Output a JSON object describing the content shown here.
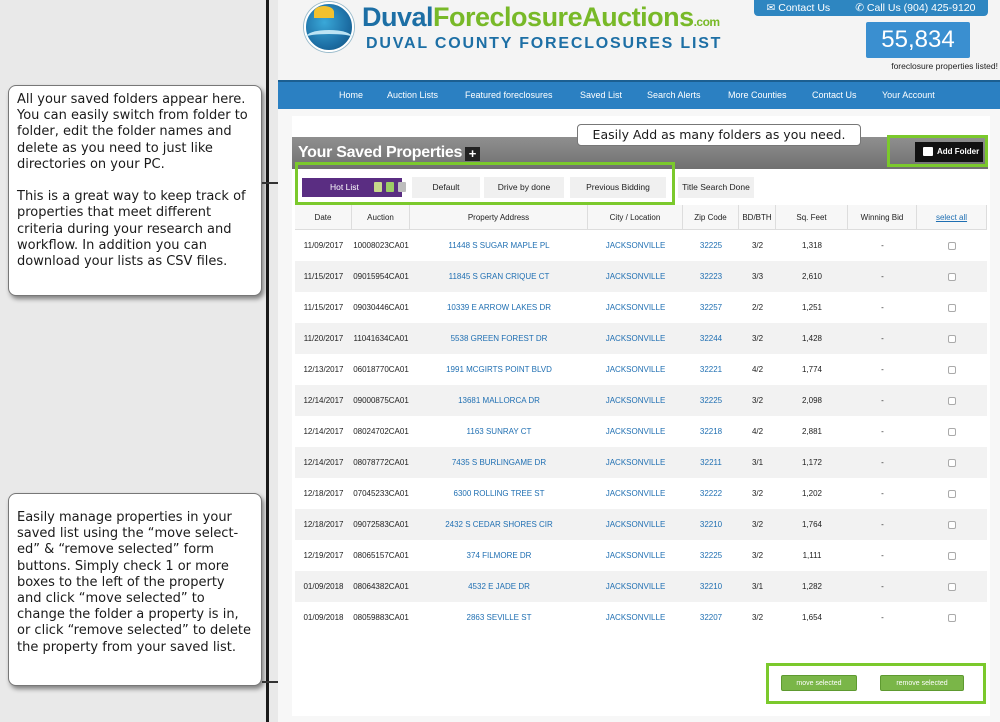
{
  "annotations": {
    "folders_note": "All your saved folders appear here. You can easily switch from folder to folder, edit the folder names and delete as you need to just like directories on your PC.\n\n This is a great way to keep track of properties that meet different criteria during your research and workflow.  In addition you can download your lists as CSV files.",
    "manage_note": "Easily manage properties in your saved list using the “move select- ed” & “remove selected” form buttons.  Simply check 1 or more boxes to the left of the property and click “move selected” to change the folder a property is in, or click “remove selected” to delete the property from your saved list.",
    "add_folder_tip": "Easily Add as many folders as you need."
  },
  "header": {
    "brand_duval": "Duval",
    "brand_fca": "ForeclosureAuctions",
    "brand_com": ".com",
    "subtitle": "DUVAL COUNTY FORECLOSURES LIST",
    "contact_us": "Contact Us",
    "call_us": "Call Us (904) 425-9120",
    "count": "55,834",
    "count_caption": "foreclosure properties listed!"
  },
  "nav": [
    "Home",
    "Auction Lists",
    "Featured foreclosures",
    "Saved List",
    "Search Alerts",
    "More Counties",
    "Contact Us",
    "Your Account"
  ],
  "saved": {
    "title": "Your Saved Properties",
    "plus": "+",
    "add_folder": "Add Folder",
    "tabs": {
      "hot": "Hot List",
      "default": "Default",
      "drive": "Drive by done",
      "previous": "Previous Bidding",
      "title_search": "Title Search Done"
    }
  },
  "table": {
    "headers": {
      "date": "Date",
      "auction": "Auction",
      "address": "Property Address",
      "city": "City / Location",
      "zip": "Zip Code",
      "bd": "BD/BTH",
      "sqft": "Sq. Feet",
      "winning": "Winning Bid",
      "select_all": "select all"
    },
    "rows": [
      {
        "date": "11/09/2017",
        "auction": "10008023CA01",
        "address": "11448 S SUGAR MAPLE PL",
        "city": "JACKSONVILLE",
        "zip": "32225",
        "bd": "3/2",
        "sqft": "1,318",
        "win": "-"
      },
      {
        "date": "11/15/2017",
        "auction": "09015954CA01",
        "address": "11845 S GRAN CRIQUE CT",
        "city": "JACKSONVILLE",
        "zip": "32223",
        "bd": "3/3",
        "sqft": "2,610",
        "win": "-"
      },
      {
        "date": "11/15/2017",
        "auction": "09030446CA01",
        "address": "10339 E ARROW LAKES DR",
        "city": "JACKSONVILLE",
        "zip": "32257",
        "bd": "2/2",
        "sqft": "1,251",
        "win": "-"
      },
      {
        "date": "11/20/2017",
        "auction": "11041634CA01",
        "address": "5538 GREEN FOREST DR",
        "city": "JACKSONVILLE",
        "zip": "32244",
        "bd": "3/2",
        "sqft": "1,428",
        "win": "-"
      },
      {
        "date": "12/13/2017",
        "auction": "06018770CA01",
        "address": "1991 MCGIRTS POINT BLVD",
        "city": "JACKSONVILLE",
        "zip": "32221",
        "bd": "4/2",
        "sqft": "1,774",
        "win": "-"
      },
      {
        "date": "12/14/2017",
        "auction": "09000875CA01",
        "address": "13681 MALLORCA DR",
        "city": "JACKSONVILLE",
        "zip": "32225",
        "bd": "3/2",
        "sqft": "2,098",
        "win": "-"
      },
      {
        "date": "12/14/2017",
        "auction": "08024702CA01",
        "address": "1163 SUNRAY CT",
        "city": "JACKSONVILLE",
        "zip": "32218",
        "bd": "4/2",
        "sqft": "2,881",
        "win": "-"
      },
      {
        "date": "12/14/2017",
        "auction": "08078772CA01",
        "address": "7435 S BURLINGAME DR",
        "city": "JACKSONVILLE",
        "zip": "32211",
        "bd": "3/1",
        "sqft": "1,172",
        "win": "-"
      },
      {
        "date": "12/18/2017",
        "auction": "07045233CA01",
        "address": "6300 ROLLING TREE ST",
        "city": "JACKSONVILLE",
        "zip": "32222",
        "bd": "3/2",
        "sqft": "1,202",
        "win": "-"
      },
      {
        "date": "12/18/2017",
        "auction": "09072583CA01",
        "address": "2432 S CEDAR SHORES CIR",
        "city": "JACKSONVILLE",
        "zip": "32210",
        "bd": "3/2",
        "sqft": "1,764",
        "win": "-"
      },
      {
        "date": "12/19/2017",
        "auction": "08065157CA01",
        "address": "374 FILMORE DR",
        "city": "JACKSONVILLE",
        "zip": "32225",
        "bd": "3/2",
        "sqft": "1,111",
        "win": "-"
      },
      {
        "date": "01/09/2018",
        "auction": "08064382CA01",
        "address": "4532 E JADE DR",
        "city": "JACKSONVILLE",
        "zip": "32210",
        "bd": "3/1",
        "sqft": "1,282",
        "win": "-"
      },
      {
        "date": "01/09/2018",
        "auction": "08059883CA01",
        "address": "2863 SEVILLE ST",
        "city": "JACKSONVILLE",
        "zip": "32207",
        "bd": "3/2",
        "sqft": "1,654",
        "win": "-"
      }
    ]
  },
  "actions": {
    "move": "move selected",
    "remove": "remove selected"
  },
  "colors": {
    "accent_blue": "#2b80c2",
    "brand_green": "#78b928",
    "highlight_green": "#7bc92c",
    "hot_list_purple": "#5a2d82",
    "action_green": "#7ab648"
  },
  "icons": [
    "envelope-icon",
    "phone-icon",
    "plus-icon",
    "folder-icon",
    "edit-icon",
    "csv-icon",
    "trash-icon",
    "checkbox-icon"
  ]
}
